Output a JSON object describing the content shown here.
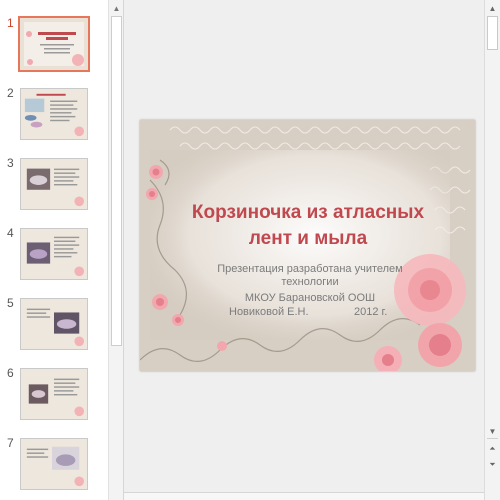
{
  "thumbnails": [
    {
      "number": "1"
    },
    {
      "number": "2"
    },
    {
      "number": "3"
    },
    {
      "number": "4"
    },
    {
      "number": "5"
    },
    {
      "number": "6"
    },
    {
      "number": "7"
    }
  ],
  "selected_slide": "1",
  "slide": {
    "title_line1": "Корзиночка из атласных",
    "title_line2": "лент и мыла",
    "subtitle_line1": "Презентация разработана учителем",
    "subtitle_line2": "технологии",
    "subtitle_line3": "МКОУ Барановской ООШ",
    "author": "Новиковой Е.Н.",
    "year": "2012 г."
  },
  "colors": {
    "title": "#c0484f",
    "subtitle": "#7b7b7b",
    "selected_border": "#e8765b",
    "selected_number": "#c9462c"
  }
}
